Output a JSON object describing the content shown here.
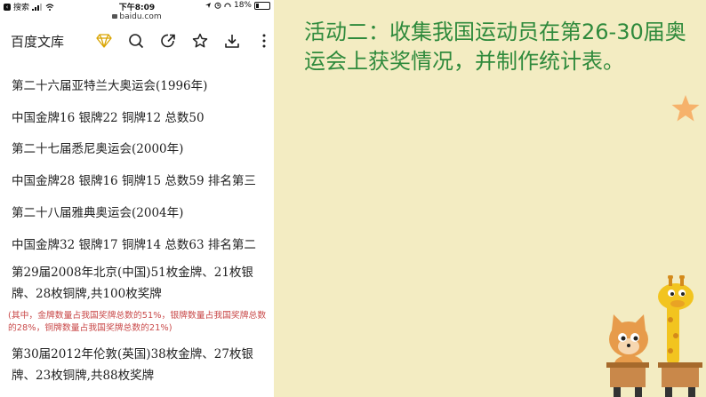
{
  "status_bar": {
    "carrier": "搜索",
    "time": "下午8:09",
    "battery": "18%"
  },
  "address_bar": {
    "domain": "baidu.com"
  },
  "toolbar": {
    "brand": "百度文库",
    "icons": [
      "diamond-icon",
      "search-icon",
      "share-icon",
      "star-icon",
      "download-icon",
      "more-icon"
    ]
  },
  "document": {
    "lines": [
      "第二十六届亚特兰大奥运会(1996年)",
      "中国金牌16 银牌22 铜牌12 总数50",
      "第二十七届悉尼奥运会(2000年)",
      "中国金牌28 银牌16 铜牌15 总数59 排名第三",
      "第二十八届雅典奥运会(2004年)",
      "中国金牌32 银牌17 铜牌14 总数63 排名第二",
      "第29届2008年北京(中国)51枚金牌、21枚银牌、28枚铜牌,共100枚奖牌",
      "第30届2012年伦敦(英国)38枚金牌、27枚银牌、23枚铜牌,共88枚奖牌"
    ],
    "note": "(其中，金牌数量占我国奖牌总数的51%，银牌数量占我国奖牌总数的28%，铜牌数量占我国奖牌总数的21%)"
  },
  "slide": {
    "heading": "活动二：收集我国运动员在第26-30届奥运会上获奖情况，并制作统计表。"
  },
  "colors": {
    "slide_background": "#f3ecc2",
    "heading": "#2f8a3c",
    "note": "#c94a4a",
    "star": "#f6b26b"
  }
}
